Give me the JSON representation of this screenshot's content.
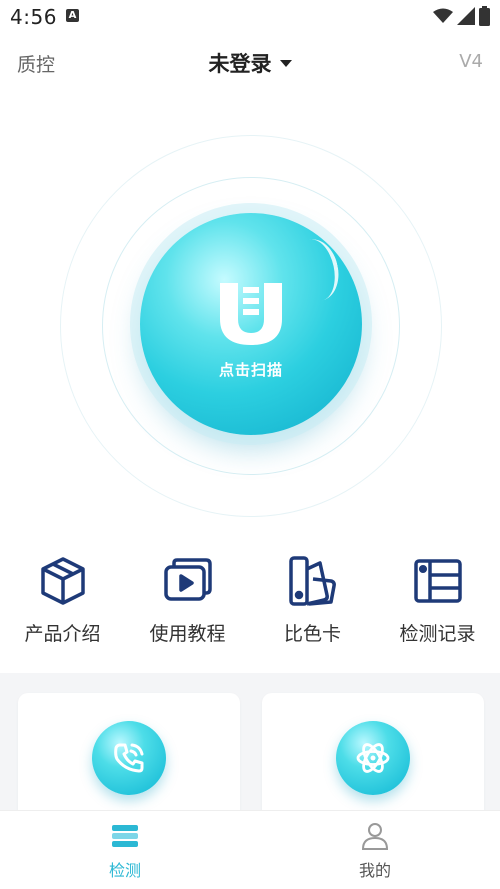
{
  "status_bar": {
    "time": "4:56",
    "notification_icon": "a-icon"
  },
  "header": {
    "left_label": "质控",
    "title": "未登录",
    "version": "V4"
  },
  "scan": {
    "label": "点击扫描"
  },
  "menu": [
    {
      "label": "产品介绍",
      "icon": "box-icon"
    },
    {
      "label": "使用教程",
      "icon": "video-icon"
    },
    {
      "label": "比色卡",
      "icon": "color-card-icon"
    },
    {
      "label": "检测记录",
      "icon": "record-icon"
    }
  ],
  "cards": [
    {
      "icon": "phone-icon"
    },
    {
      "icon": "atom-icon"
    }
  ],
  "bottom_nav": [
    {
      "label": "检测",
      "icon": "detect-icon",
      "active": true
    },
    {
      "label": "我的",
      "icon": "user-icon",
      "active": false
    }
  ],
  "colors": {
    "accent": "#2bb8d4",
    "icon_navy": "#1e3a78",
    "card_bg": "#f4f5f7"
  }
}
